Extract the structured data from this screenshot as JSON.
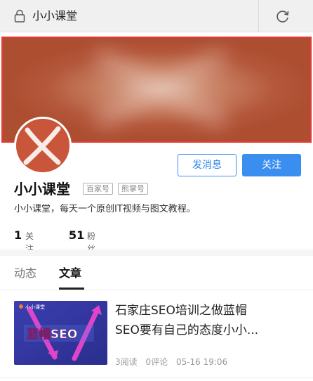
{
  "address_bar": {
    "title": "小小课堂",
    "lock_icon": "lock-icon",
    "reload_icon": "reload-icon"
  },
  "profile": {
    "name": "小小课堂",
    "badges": [
      "百家号",
      "熊掌号"
    ],
    "bio": "小小课堂，每天一个原创IT视频与图文教程。",
    "buttons": {
      "message": "发消息",
      "follow": "关注"
    },
    "stats": {
      "following_count": "1",
      "following_label": "关注",
      "fans_count": "51",
      "fans_label": "粉丝"
    }
  },
  "tabs": [
    {
      "label": "动态",
      "active": false
    },
    {
      "label": "文章",
      "active": true
    }
  ],
  "articles": [
    {
      "title_line1": "石家庄SEO培训之做蓝帽",
      "title_line2": "SEO要有自己的态度小小...",
      "reads": "3阅读",
      "comments": "0评论",
      "date": "05-16 19:06",
      "thumb_brand": "小小课堂",
      "thumb_text": "蓝帽SEO"
    }
  ],
  "colors": {
    "accent": "#3a8ef0",
    "banner": "#b4573a",
    "highlight_border": "#e53935"
  }
}
